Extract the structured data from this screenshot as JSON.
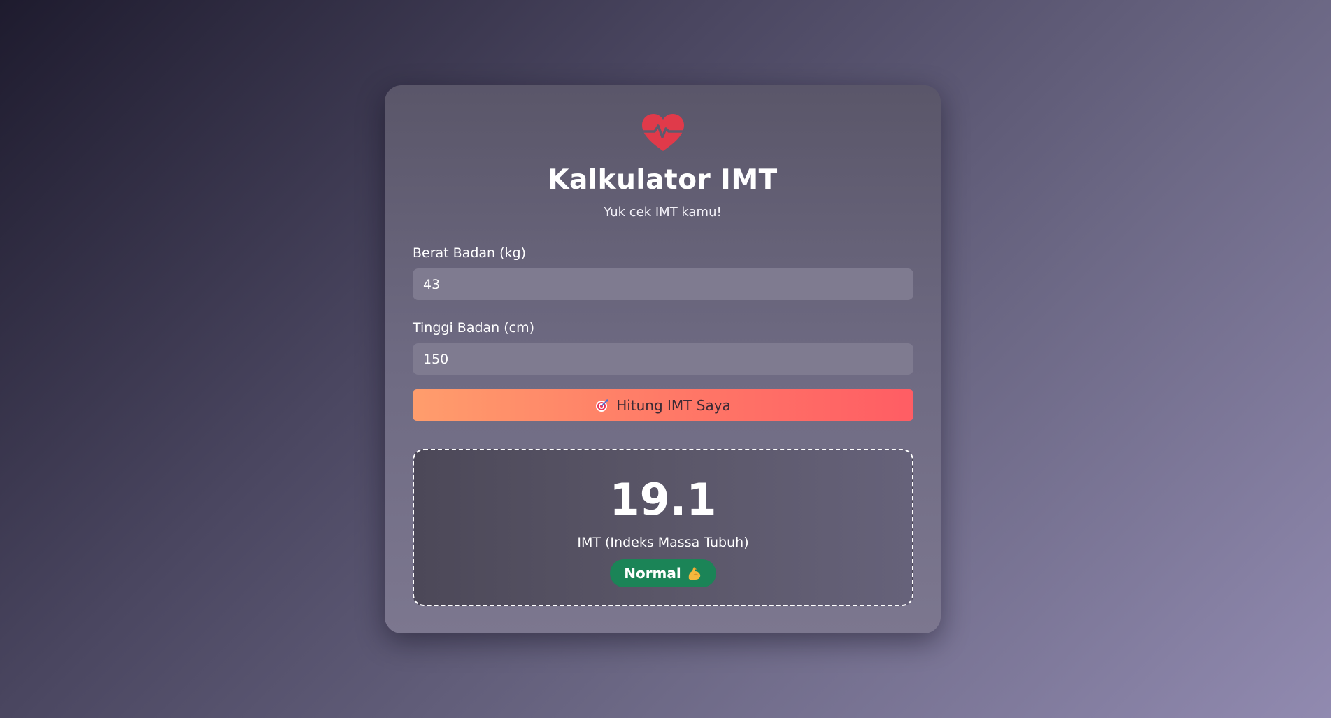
{
  "app": {
    "title": "Kalkulator IMT",
    "subtitle": "Yuk cek IMT kamu!",
    "logo_icon": "heart-pulse-icon",
    "accent_color": "#e03a4a"
  },
  "form": {
    "weight_label": "Berat Badan (kg)",
    "weight_value": "43",
    "height_label": "Tinggi Badan (cm)",
    "height_value": "150",
    "submit_label": "Hitung IMT Saya",
    "submit_icon": "target-icon"
  },
  "result": {
    "value": "19.1",
    "caption": "IMT (Indeks Massa Tubuh)",
    "status": "Normal",
    "status_icon": "flexed-biceps-icon",
    "status_color": "#1b8457"
  }
}
